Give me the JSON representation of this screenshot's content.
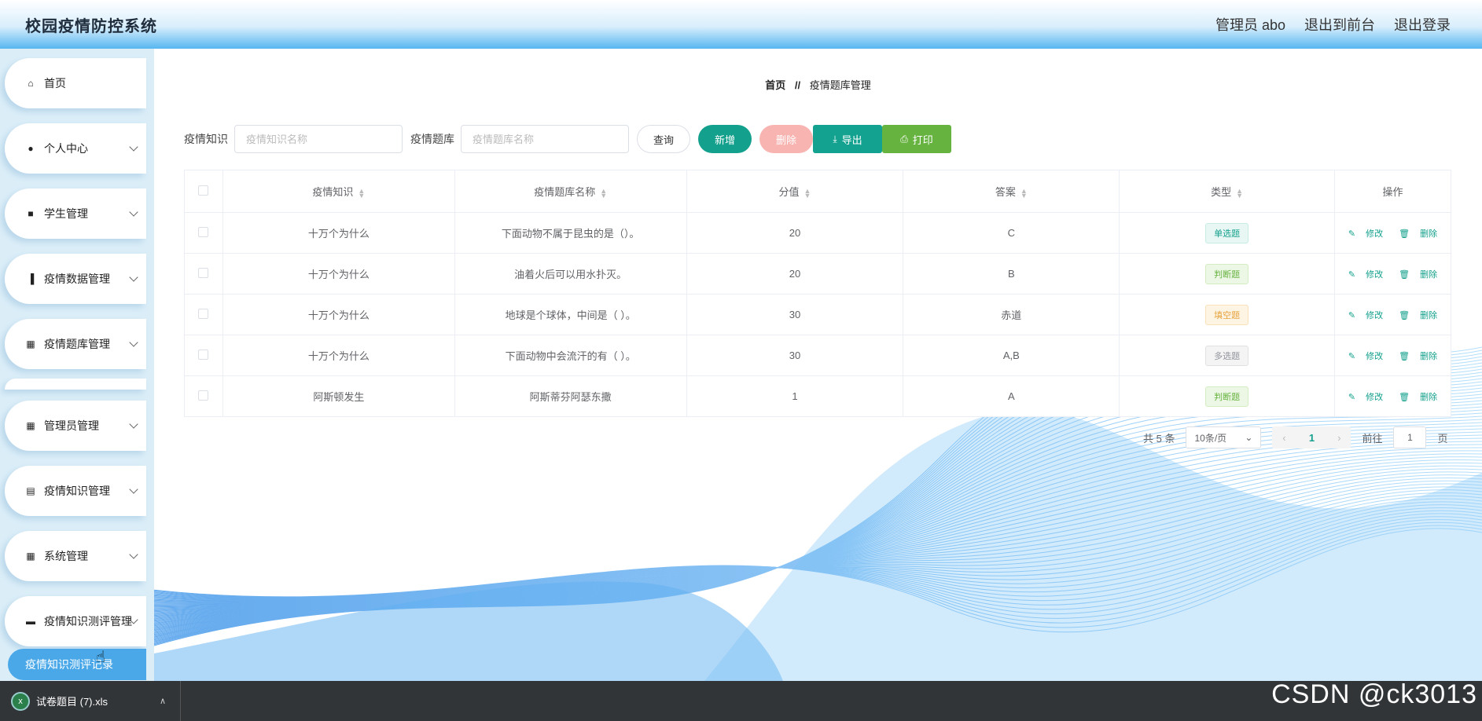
{
  "header": {
    "title": "校园疫情防控系统",
    "user": "管理员 abo",
    "back_to_front": "退出到前台",
    "logout": "退出登录"
  },
  "sidebar": {
    "items": [
      {
        "label": "首页",
        "icon": "home-icon",
        "has_children": false
      },
      {
        "label": "个人中心",
        "icon": "user-icon",
        "has_children": true
      },
      {
        "label": "学生管理",
        "icon": "briefcase-icon",
        "has_children": true
      },
      {
        "label": "疫情数据管理",
        "icon": "bar-chart-icon",
        "has_children": true
      },
      {
        "label": "疫情题库管理",
        "icon": "grid-icon",
        "has_children": true
      },
      {
        "label": "管理员管理",
        "icon": "grid-icon",
        "has_children": true
      },
      {
        "label": "疫情知识管理",
        "icon": "clipboard-icon",
        "has_children": true
      },
      {
        "label": "系统管理",
        "icon": "grid-icon",
        "has_children": true
      },
      {
        "label": "疫情知识测评管理",
        "icon": "monitor-icon",
        "has_children": true
      }
    ],
    "active_sub": "疫情知识测评记录"
  },
  "breadcrumb": {
    "home": "首页",
    "separator": "//",
    "current": "疫情题库管理"
  },
  "search": {
    "knowledge_label": "疫情知识",
    "knowledge_placeholder": "疫情知识名称",
    "bank_label": "疫情题库",
    "bank_placeholder": "疫情题库名称",
    "query": "查询",
    "add": "新增",
    "delete": "删除",
    "export": "导出",
    "print": "打印"
  },
  "table": {
    "columns": [
      "疫情知识",
      "疫情题库名称",
      "分值",
      "答案",
      "类型",
      "操作"
    ],
    "edit_label": "修改",
    "delete_label": "删除",
    "rows": [
      {
        "knowledge": "十万个为什么",
        "question": "下面动物不属于昆虫的是（）。",
        "score": "20",
        "answer": "C",
        "type": "单选题",
        "type_kind": "single"
      },
      {
        "knowledge": "十万个为什么",
        "question": "油着火后可以用水扑灭。",
        "score": "20",
        "answer": "B",
        "type": "判断题",
        "type_kind": "judge"
      },
      {
        "knowledge": "十万个为什么",
        "question": "地球是个球体，中间是（ ）。",
        "score": "30",
        "answer": "赤道",
        "type": "填空题",
        "type_kind": "fill"
      },
      {
        "knowledge": "十万个为什么",
        "question": "下面动物中会流汗的有（ ）。",
        "score": "30",
        "answer": "A,B",
        "type": "多选题",
        "type_kind": "multi"
      },
      {
        "knowledge": "阿斯顿发生",
        "question": "阿斯蒂芬阿瑟东撒",
        "score": "1",
        "answer": "A",
        "type": "判断题",
        "type_kind": "judge"
      }
    ]
  },
  "pagination": {
    "total": "共 5 条",
    "page_size": "10条/页",
    "current_page": "1",
    "goto_label": "前往",
    "goto_value": "1",
    "page_unit": "页"
  },
  "taskbar": {
    "download_name": "试卷题目 (7).xls",
    "watermark": "CSDN @ck3013"
  },
  "colors": {
    "accent": "#13a08c",
    "sidebar_bg": "#dbeef8",
    "header_gradient_end": "#56b6f0"
  }
}
